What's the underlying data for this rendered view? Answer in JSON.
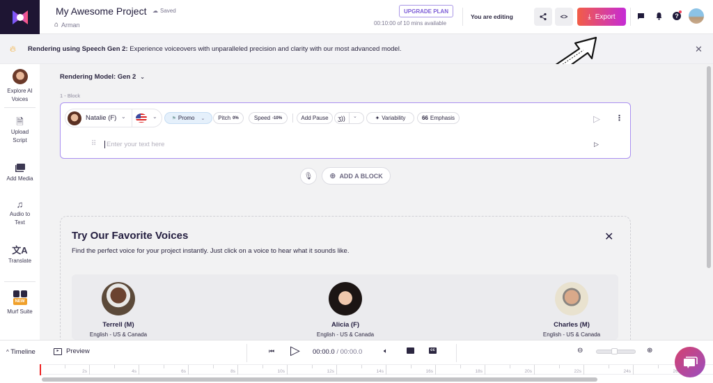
{
  "header": {
    "project_title": "My Awesome Project",
    "save_status": "Saved",
    "owner": "Arman",
    "upgrade_label": "UPGRADE PLAN",
    "minutes_available": "00:10:00 of 10 mins available",
    "editing_status": "You are editing",
    "export_label": "Export",
    "icons": [
      "share-icon",
      "embed-code-icon",
      "download-icon",
      "comment-icon",
      "bell-icon",
      "help-icon",
      "user-avatar"
    ]
  },
  "banner": {
    "bold": "Rendering using Speech Gen 2:",
    "text": " Experience voiceovers with unparalleled precision and clarity with our most advanced model."
  },
  "sidebar": {
    "items": [
      {
        "label1": "Explore AI",
        "label2": "Voices"
      },
      {
        "label1": "Upload",
        "label2": "Script"
      },
      {
        "label1": "Add Media",
        "label2": ""
      },
      {
        "label1": "Audio to",
        "label2": "Text"
      },
      {
        "label1": "Translate",
        "label2": ""
      },
      {
        "label1": "Murf Suite",
        "label2": "",
        "badge": "NEW"
      }
    ]
  },
  "editor": {
    "model_label": "Rendering Model: Gen 2",
    "block_label": "1 -  Block",
    "voice": "Natalie (F)",
    "style": "Promo",
    "pitch_label": "Pitch",
    "pitch_value": "0%",
    "speed_label": "Speed",
    "speed_value": "-10%",
    "add_pause": "Add Pause",
    "variability": "Variability",
    "emphasis": "Emphasis",
    "text_placeholder": "Enter your text here",
    "add_block": "ADD A BLOCK"
  },
  "favorites": {
    "title": "Try Our Favorite Voices",
    "description": "Find the perfect voice for your project instantly. Just click on a voice to hear what it sounds like.",
    "voices": [
      {
        "name": "Terrell (M)",
        "lang": "English - US & Canada"
      },
      {
        "name": "Alicia (F)",
        "lang": "English - US & Canada"
      },
      {
        "name": "Charles (M)",
        "lang": "English - US & Canada"
      }
    ]
  },
  "timeline": {
    "toggle_label": "Timeline",
    "preview_label": "Preview",
    "current_time": "00:00.0",
    "total_time": " / 00:00.0",
    "zoom_level": 0.45,
    "ticks": [
      "2s",
      "4s",
      "6s",
      "8s",
      "10s",
      "12s",
      "14s",
      "16s",
      "18s",
      "20s",
      "22s",
      "24s",
      "26s"
    ]
  }
}
